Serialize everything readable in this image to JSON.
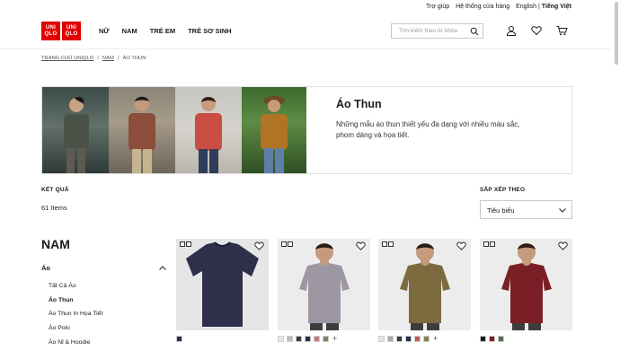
{
  "utility": {
    "help": "Trợ giúp",
    "stores": "Hệ thống cửa hàng",
    "lang_en": "English",
    "lang_sep": "|",
    "lang_vi": "Tiếng Việt"
  },
  "logo": {
    "top_left": "UNI",
    "top_right": "UNI",
    "bottom_left": "QLO",
    "bottom_right": "QLO"
  },
  "nav": [
    "NỮ",
    "NAM",
    "TRẺ EM",
    "TRẺ SƠ SINH"
  ],
  "search": {
    "placeholder": "Tìm kiếm theo từ khóa"
  },
  "breadcrumb": [
    "TRANG CHỦ UNIQLO",
    "NAM",
    "ÁO THUN"
  ],
  "breadcrumb_sep": "/",
  "hero": {
    "title": "Áo Thun",
    "description": "Những mẫu áo thun thiết yếu đa dạng với nhiều màu sắc, phom dáng và họa tiết."
  },
  "results": {
    "label": "KẾT QUẢ",
    "count": "61 Items"
  },
  "sort": {
    "label": "SẮP XẾP THEO",
    "value": "Tiêu biểu"
  },
  "sidebar": {
    "title": "NAM",
    "category": "Áo",
    "items": [
      "Tất Cả Áo",
      "Áo Thun",
      "Áo Thun In Họa Tiết",
      "Áo Polo",
      "Áo Nỉ & Hoodie"
    ],
    "active": "Áo Thun"
  },
  "products": [
    {
      "shirt_color": "#2e2f4a",
      "bg": "#e6e6e6",
      "swatches": [
        "#2e2f4a"
      ],
      "more": false
    },
    {
      "shirt_color": "#9d97a3",
      "bg": "#ececec",
      "swatches": [
        "#e5e5e5",
        "#bdbdbd",
        "#3c3c3c",
        "#243049",
        "#b77d7e",
        "#8a7d64"
      ],
      "more": true
    },
    {
      "shirt_color": "#7c6b3f",
      "bg": "#ececec",
      "swatches": [
        "#e5e5e5",
        "#a8a8a8",
        "#3c3c3c",
        "#243049",
        "#c15c5c",
        "#8a7d50"
      ],
      "more": true
    },
    {
      "shirt_color": "#7b1f27",
      "bg": "#ececec",
      "swatches": [
        "#1b1b1b",
        "#7b1f27",
        "#556b4f"
      ],
      "more": false
    }
  ]
}
